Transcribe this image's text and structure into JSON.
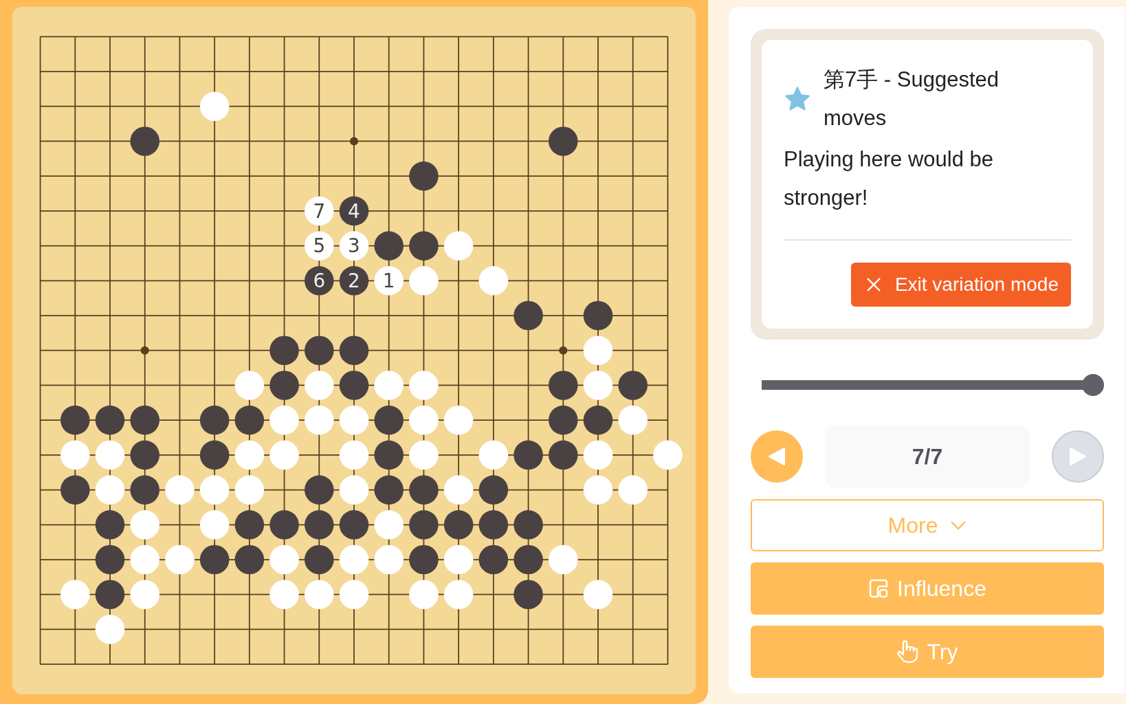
{
  "board": {
    "rows": [
      [
        {
          "kind": "empty"
        },
        {
          "kind": "empty"
        },
        {
          "kind": "empty"
        },
        {
          "kind": "empty"
        },
        {
          "kind": "empty"
        },
        {
          "kind": "empty"
        },
        {
          "kind": "empty"
        },
        {
          "kind": "empty"
        },
        {
          "kind": "empty"
        },
        {
          "kind": "empty"
        },
        {
          "kind": "empty"
        },
        {
          "kind": "empty"
        },
        {
          "kind": "empty"
        },
        {
          "kind": "empty"
        },
        {
          "kind": "empty"
        },
        {
          "kind": "empty"
        },
        {
          "kind": "empty"
        },
        {
          "kind": "empty"
        },
        {
          "kind": "empty"
        }
      ],
      [
        {
          "kind": "empty"
        },
        {
          "kind": "empty"
        },
        {
          "kind": "empty"
        },
        {
          "kind": "empty"
        },
        {
          "kind": "empty"
        },
        {
          "kind": "empty"
        },
        {
          "kind": "empty"
        },
        {
          "kind": "empty"
        },
        {
          "kind": "empty"
        },
        {
          "kind": "empty"
        },
        {
          "kind": "empty"
        },
        {
          "kind": "empty"
        },
        {
          "kind": "empty"
        },
        {
          "kind": "empty"
        },
        {
          "kind": "empty"
        },
        {
          "kind": "empty"
        },
        {
          "kind": "empty"
        },
        {
          "kind": "empty"
        },
        {
          "kind": "empty"
        }
      ],
      [
        {
          "kind": "empty"
        },
        {
          "kind": "empty"
        },
        {
          "kind": "empty"
        },
        {
          "kind": "empty"
        },
        {
          "kind": "empty"
        },
        {
          "kind": "white"
        },
        {
          "kind": "empty"
        },
        {
          "kind": "empty"
        },
        {
          "kind": "empty"
        },
        {
          "kind": "empty"
        },
        {
          "kind": "empty"
        },
        {
          "kind": "empty"
        },
        {
          "kind": "empty"
        },
        {
          "kind": "empty"
        },
        {
          "kind": "empty"
        },
        {
          "kind": "empty"
        },
        {
          "kind": "empty"
        },
        {
          "kind": "empty"
        },
        {
          "kind": "empty"
        }
      ],
      [
        {
          "kind": "empty"
        },
        {
          "kind": "empty"
        },
        {
          "kind": "empty"
        },
        {
          "kind": "black"
        },
        {
          "kind": "empty"
        },
        {
          "kind": "empty"
        },
        {
          "kind": "empty"
        },
        {
          "kind": "empty"
        },
        {
          "kind": "empty"
        },
        {
          "kind": "star"
        },
        {
          "kind": "empty"
        },
        {
          "kind": "empty"
        },
        {
          "kind": "empty"
        },
        {
          "kind": "empty"
        },
        {
          "kind": "empty"
        },
        {
          "kind": "black"
        },
        {
          "kind": "empty"
        },
        {
          "kind": "empty"
        },
        {
          "kind": "empty"
        }
      ],
      [
        {
          "kind": "empty"
        },
        {
          "kind": "empty"
        },
        {
          "kind": "empty"
        },
        {
          "kind": "empty"
        },
        {
          "kind": "empty"
        },
        {
          "kind": "empty"
        },
        {
          "kind": "empty"
        },
        {
          "kind": "empty"
        },
        {
          "kind": "empty"
        },
        {
          "kind": "empty"
        },
        {
          "kind": "empty"
        },
        {
          "kind": "black"
        },
        {
          "kind": "empty"
        },
        {
          "kind": "empty"
        },
        {
          "kind": "empty"
        },
        {
          "kind": "empty"
        },
        {
          "kind": "empty"
        },
        {
          "kind": "empty"
        },
        {
          "kind": "empty"
        }
      ],
      [
        {
          "kind": "empty"
        },
        {
          "kind": "empty"
        },
        {
          "kind": "empty"
        },
        {
          "kind": "empty"
        },
        {
          "kind": "empty"
        },
        {
          "kind": "empty"
        },
        {
          "kind": "empty"
        },
        {
          "kind": "empty"
        },
        {
          "kind": "white",
          "label": "7"
        },
        {
          "kind": "black",
          "label": "4"
        },
        {
          "kind": "empty"
        },
        {
          "kind": "empty"
        },
        {
          "kind": "empty"
        },
        {
          "kind": "empty"
        },
        {
          "kind": "empty"
        },
        {
          "kind": "empty"
        },
        {
          "kind": "empty"
        },
        {
          "kind": "empty"
        },
        {
          "kind": "empty"
        }
      ],
      [
        {
          "kind": "empty"
        },
        {
          "kind": "empty"
        },
        {
          "kind": "empty"
        },
        {
          "kind": "empty"
        },
        {
          "kind": "empty"
        },
        {
          "kind": "empty"
        },
        {
          "kind": "empty"
        },
        {
          "kind": "empty"
        },
        {
          "kind": "white",
          "label": "5"
        },
        {
          "kind": "white",
          "label": "3"
        },
        {
          "kind": "black"
        },
        {
          "kind": "black"
        },
        {
          "kind": "white"
        },
        {
          "kind": "empty"
        },
        {
          "kind": "empty"
        },
        {
          "kind": "empty"
        },
        {
          "kind": "empty"
        },
        {
          "kind": "empty"
        },
        {
          "kind": "empty"
        }
      ],
      [
        {
          "kind": "empty"
        },
        {
          "kind": "empty"
        },
        {
          "kind": "empty"
        },
        {
          "kind": "empty"
        },
        {
          "kind": "empty"
        },
        {
          "kind": "empty"
        },
        {
          "kind": "empty"
        },
        {
          "kind": "empty"
        },
        {
          "kind": "black",
          "label": "6"
        },
        {
          "kind": "black",
          "label": "2"
        },
        {
          "kind": "white",
          "label": "1"
        },
        {
          "kind": "white"
        },
        {
          "kind": "empty"
        },
        {
          "kind": "white"
        },
        {
          "kind": "empty"
        },
        {
          "kind": "empty"
        },
        {
          "kind": "empty"
        },
        {
          "kind": "empty"
        },
        {
          "kind": "empty"
        }
      ],
      [
        {
          "kind": "empty"
        },
        {
          "kind": "empty"
        },
        {
          "kind": "empty"
        },
        {
          "kind": "empty"
        },
        {
          "kind": "empty"
        },
        {
          "kind": "empty"
        },
        {
          "kind": "empty"
        },
        {
          "kind": "empty"
        },
        {
          "kind": "empty"
        },
        {
          "kind": "empty"
        },
        {
          "kind": "empty"
        },
        {
          "kind": "empty"
        },
        {
          "kind": "empty"
        },
        {
          "kind": "empty"
        },
        {
          "kind": "black"
        },
        {
          "kind": "empty"
        },
        {
          "kind": "black"
        },
        {
          "kind": "empty"
        },
        {
          "kind": "empty"
        }
      ],
      [
        {
          "kind": "empty"
        },
        {
          "kind": "empty"
        },
        {
          "kind": "empty"
        },
        {
          "kind": "star"
        },
        {
          "kind": "empty"
        },
        {
          "kind": "empty"
        },
        {
          "kind": "empty"
        },
        {
          "kind": "black"
        },
        {
          "kind": "black"
        },
        {
          "kind": "black"
        },
        {
          "kind": "empty"
        },
        {
          "kind": "empty"
        },
        {
          "kind": "empty"
        },
        {
          "kind": "empty"
        },
        {
          "kind": "empty"
        },
        {
          "kind": "star"
        },
        {
          "kind": "white"
        },
        {
          "kind": "empty"
        },
        {
          "kind": "empty"
        }
      ],
      [
        {
          "kind": "empty"
        },
        {
          "kind": "empty"
        },
        {
          "kind": "empty"
        },
        {
          "kind": "empty"
        },
        {
          "kind": "empty"
        },
        {
          "kind": "empty"
        },
        {
          "kind": "white"
        },
        {
          "kind": "black"
        },
        {
          "kind": "white"
        },
        {
          "kind": "black"
        },
        {
          "kind": "white"
        },
        {
          "kind": "white"
        },
        {
          "kind": "empty"
        },
        {
          "kind": "empty"
        },
        {
          "kind": "empty"
        },
        {
          "kind": "black"
        },
        {
          "kind": "white"
        },
        {
          "kind": "black"
        },
        {
          "kind": "empty"
        }
      ],
      [
        {
          "kind": "empty"
        },
        {
          "kind": "black"
        },
        {
          "kind": "black"
        },
        {
          "kind": "black"
        },
        {
          "kind": "empty"
        },
        {
          "kind": "black"
        },
        {
          "kind": "black"
        },
        {
          "kind": "white"
        },
        {
          "kind": "white"
        },
        {
          "kind": "white"
        },
        {
          "kind": "black"
        },
        {
          "kind": "white"
        },
        {
          "kind": "white"
        },
        {
          "kind": "empty"
        },
        {
          "kind": "empty"
        },
        {
          "kind": "black"
        },
        {
          "kind": "black"
        },
        {
          "kind": "white"
        },
        {
          "kind": "empty"
        }
      ],
      [
        {
          "kind": "empty"
        },
        {
          "kind": "white"
        },
        {
          "kind": "white"
        },
        {
          "kind": "black"
        },
        {
          "kind": "empty"
        },
        {
          "kind": "black"
        },
        {
          "kind": "white"
        },
        {
          "kind": "white"
        },
        {
          "kind": "empty"
        },
        {
          "kind": "white"
        },
        {
          "kind": "black"
        },
        {
          "kind": "white"
        },
        {
          "kind": "empty"
        },
        {
          "kind": "white"
        },
        {
          "kind": "black"
        },
        {
          "kind": "black"
        },
        {
          "kind": "white"
        },
        {
          "kind": "empty"
        },
        {
          "kind": "white"
        }
      ],
      [
        {
          "kind": "empty"
        },
        {
          "kind": "black"
        },
        {
          "kind": "white"
        },
        {
          "kind": "black"
        },
        {
          "kind": "white"
        },
        {
          "kind": "white"
        },
        {
          "kind": "white"
        },
        {
          "kind": "empty"
        },
        {
          "kind": "black"
        },
        {
          "kind": "white"
        },
        {
          "kind": "black"
        },
        {
          "kind": "black"
        },
        {
          "kind": "white"
        },
        {
          "kind": "black"
        },
        {
          "kind": "empty"
        },
        {
          "kind": "empty"
        },
        {
          "kind": "white"
        },
        {
          "kind": "white"
        },
        {
          "kind": "empty"
        }
      ],
      [
        {
          "kind": "empty"
        },
        {
          "kind": "empty"
        },
        {
          "kind": "black"
        },
        {
          "kind": "white"
        },
        {
          "kind": "empty"
        },
        {
          "kind": "white"
        },
        {
          "kind": "black"
        },
        {
          "kind": "black"
        },
        {
          "kind": "black"
        },
        {
          "kind": "black"
        },
        {
          "kind": "white"
        },
        {
          "kind": "black"
        },
        {
          "kind": "black"
        },
        {
          "kind": "black"
        },
        {
          "kind": "black"
        },
        {
          "kind": "empty"
        },
        {
          "kind": "empty"
        },
        {
          "kind": "empty"
        },
        {
          "kind": "empty"
        }
      ],
      [
        {
          "kind": "empty"
        },
        {
          "kind": "empty"
        },
        {
          "kind": "black"
        },
        {
          "kind": "white"
        },
        {
          "kind": "white"
        },
        {
          "kind": "black"
        },
        {
          "kind": "black"
        },
        {
          "kind": "white"
        },
        {
          "kind": "black"
        },
        {
          "kind": "white"
        },
        {
          "kind": "white"
        },
        {
          "kind": "black"
        },
        {
          "kind": "white"
        },
        {
          "kind": "black"
        },
        {
          "kind": "black"
        },
        {
          "kind": "white"
        },
        {
          "kind": "empty"
        },
        {
          "kind": "empty"
        },
        {
          "kind": "empty"
        }
      ],
      [
        {
          "kind": "empty"
        },
        {
          "kind": "white"
        },
        {
          "kind": "black"
        },
        {
          "kind": "white"
        },
        {
          "kind": "empty"
        },
        {
          "kind": "empty"
        },
        {
          "kind": "empty"
        },
        {
          "kind": "white"
        },
        {
          "kind": "white"
        },
        {
          "kind": "white"
        },
        {
          "kind": "empty"
        },
        {
          "kind": "white"
        },
        {
          "kind": "white"
        },
        {
          "kind": "empty"
        },
        {
          "kind": "black"
        },
        {
          "kind": "empty"
        },
        {
          "kind": "white"
        },
        {
          "kind": "empty"
        },
        {
          "kind": "empty"
        }
      ],
      [
        {
          "kind": "empty"
        },
        {
          "kind": "empty"
        },
        {
          "kind": "white"
        },
        {
          "kind": "empty"
        },
        {
          "kind": "empty"
        },
        {
          "kind": "empty"
        },
        {
          "kind": "empty"
        },
        {
          "kind": "empty"
        },
        {
          "kind": "empty"
        },
        {
          "kind": "empty"
        },
        {
          "kind": "empty"
        },
        {
          "kind": "empty"
        },
        {
          "kind": "empty"
        },
        {
          "kind": "empty"
        },
        {
          "kind": "empty"
        },
        {
          "kind": "empty"
        },
        {
          "kind": "empty"
        },
        {
          "kind": "empty"
        },
        {
          "kind": "empty"
        }
      ],
      [
        {
          "kind": "empty"
        },
        {
          "kind": "empty"
        },
        {
          "kind": "empty"
        },
        {
          "kind": "empty"
        },
        {
          "kind": "empty"
        },
        {
          "kind": "empty"
        },
        {
          "kind": "empty"
        },
        {
          "kind": "empty"
        },
        {
          "kind": "empty"
        },
        {
          "kind": "empty"
        },
        {
          "kind": "empty"
        },
        {
          "kind": "empty"
        },
        {
          "kind": "empty"
        },
        {
          "kind": "empty"
        },
        {
          "kind": "empty"
        },
        {
          "kind": "empty"
        },
        {
          "kind": "empty"
        },
        {
          "kind": "empty"
        },
        {
          "kind": "empty"
        }
      ]
    ]
  },
  "hint": {
    "title": "第7手 - Suggested moves",
    "message": "Playing here would be stronger!",
    "exit_button": "Exit variation mode"
  },
  "slider": {
    "level": 1
  },
  "navigation": {
    "previous_disabled": false,
    "counter": "7/7",
    "next_disabled": true
  },
  "more_button": "More",
  "actions": [
    {
      "kind": "influence",
      "label": "Influence"
    },
    {
      "kind": "try",
      "label": "Try"
    }
  ]
}
